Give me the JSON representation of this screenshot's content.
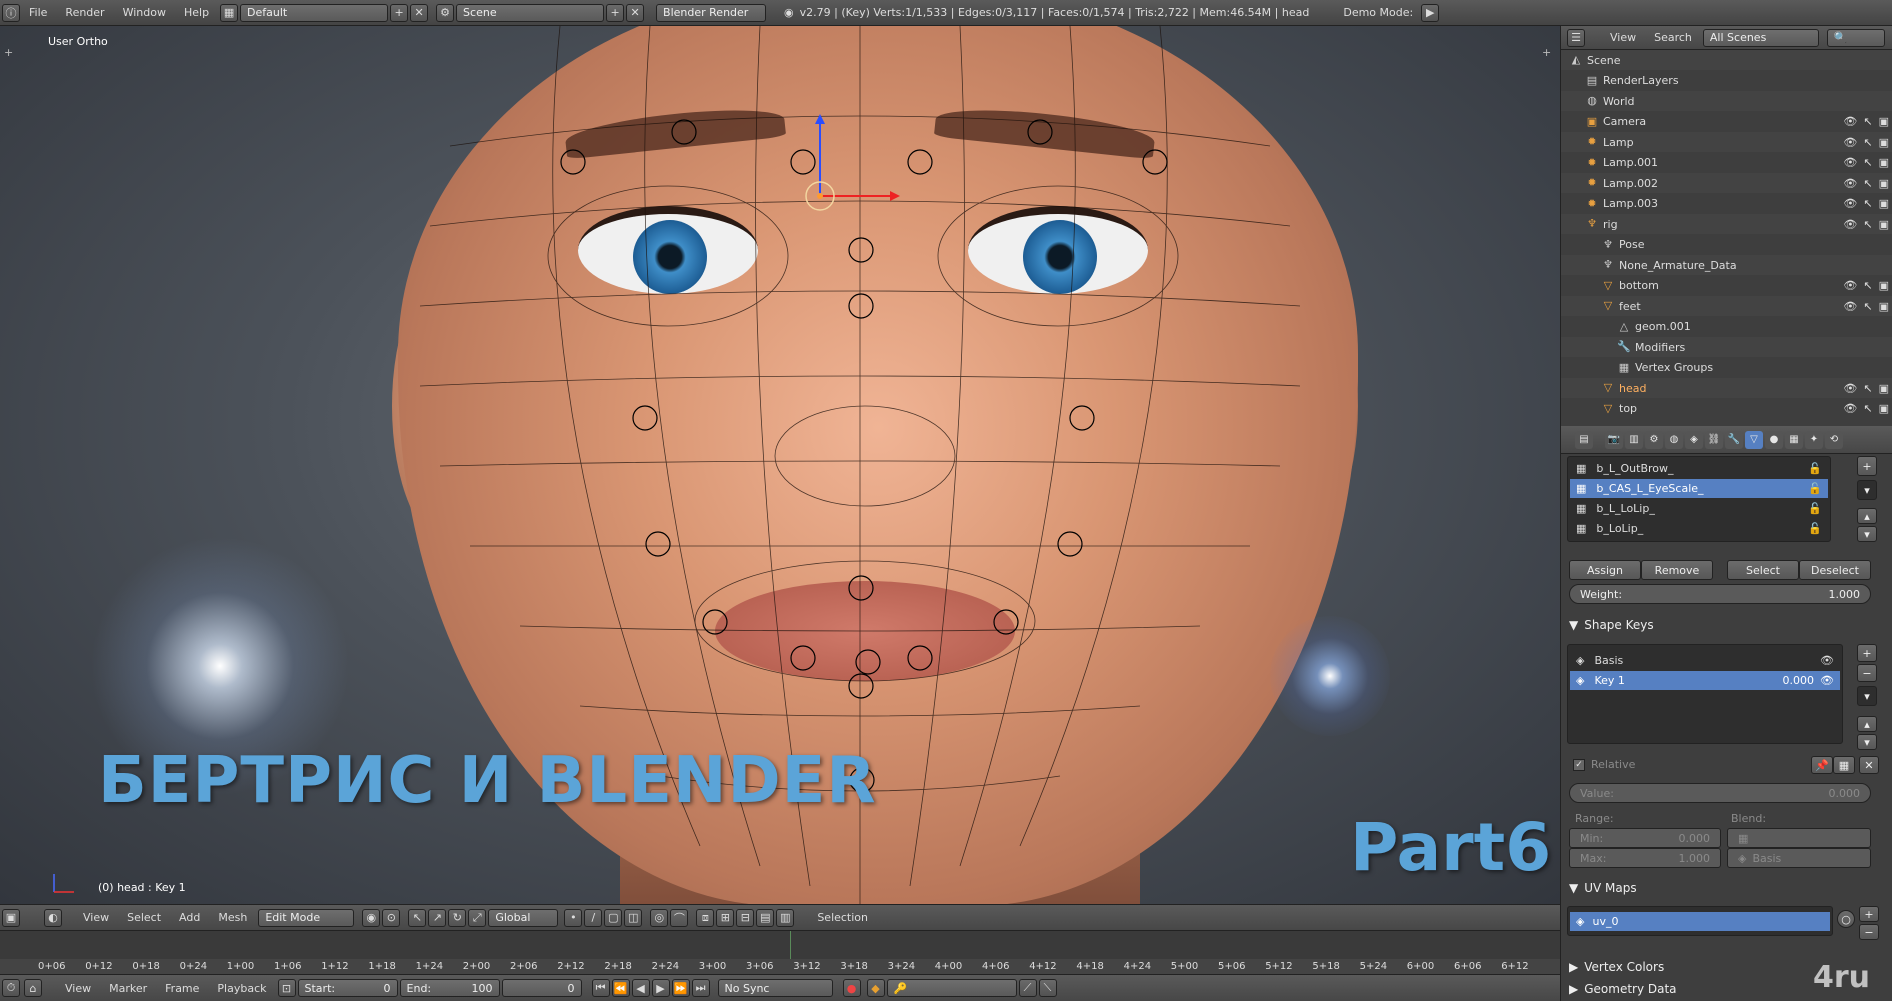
{
  "topbar": {
    "menus": [
      "File",
      "Render",
      "Window",
      "Help"
    ],
    "layout": "Default",
    "scene": "Scene",
    "engine": "Blender Render",
    "stats": "v2.79 | (Key) Verts:1/1,533 | Edges:0/3,117 | Faces:0/1,574 | Tris:2,722 | Mem:46.54M | head",
    "demo_mode": "Demo Mode:"
  },
  "viewport": {
    "view_label": "User Ortho",
    "object_label": "(0) head : Key 1",
    "overlay_title": "БЕРТРИС И BLENDER",
    "overlay_part": "Part6"
  },
  "viewport_header": {
    "menus": [
      "View",
      "Select",
      "Add",
      "Mesh"
    ],
    "mode": "Edit Mode",
    "orientation": "Global",
    "selection_label": "Selection"
  },
  "timeline": {
    "ticks": [
      "0+06",
      "0+12",
      "0+18",
      "0+24",
      "1+00",
      "1+06",
      "1+12",
      "1+18",
      "1+24",
      "2+00",
      "2+06",
      "2+12",
      "2+18",
      "2+24",
      "3+00",
      "3+06",
      "3+12",
      "3+18",
      "3+24",
      "4+00",
      "4+06",
      "4+12",
      "4+18",
      "4+24",
      "5+00",
      "5+06",
      "5+12",
      "5+18",
      "5+24",
      "6+00",
      "6+06",
      "6+12"
    ],
    "menus": [
      "View",
      "Marker",
      "Frame",
      "Playback"
    ],
    "start_label": "Start:",
    "start_value": "0",
    "end_label": "End:",
    "end_value": "100",
    "current_frame": "0",
    "sync": "No Sync"
  },
  "outliner": {
    "menus": [
      "View",
      "Search"
    ],
    "filter": "All Scenes",
    "rows": [
      {
        "label": "Scene",
        "icon": "scene-icon"
      },
      {
        "label": "RenderLayers",
        "icon": "render-layers-icon"
      },
      {
        "label": "World",
        "icon": "world-icon"
      },
      {
        "label": "Camera",
        "icon": "camera-icon"
      },
      {
        "label": "Lamp",
        "icon": "lamp-icon"
      },
      {
        "label": "Lamp.001",
        "icon": "lamp-icon"
      },
      {
        "label": "Lamp.002",
        "icon": "lamp-icon"
      },
      {
        "label": "Lamp.003",
        "icon": "lamp-icon"
      },
      {
        "label": "rig",
        "icon": "armature-icon"
      },
      {
        "label": "Pose",
        "icon": "pose-icon"
      },
      {
        "label": "None_Armature_Data",
        "icon": "armature-data-icon"
      },
      {
        "label": "bottom",
        "icon": "mesh-icon"
      },
      {
        "label": "feet",
        "icon": "mesh-icon"
      },
      {
        "label": "geom.001",
        "icon": "mesh-data-icon"
      },
      {
        "label": "Modifiers",
        "icon": "wrench-icon"
      },
      {
        "label": "Vertex Groups",
        "icon": "vertex-group-icon"
      },
      {
        "label": "head",
        "icon": "mesh-icon"
      },
      {
        "label": "top",
        "icon": "mesh-icon"
      }
    ]
  },
  "properties": {
    "vertex_groups": [
      "b_L_OutBrow_",
      "b_CAS_L_EyeScale_",
      "b_L_LoLip_",
      "b_LoLip_"
    ],
    "vg_buttons": {
      "assign": "Assign",
      "remove": "Remove",
      "select": "Select",
      "deselect": "Deselect"
    },
    "weight_label": "Weight:",
    "weight_value": "1.000",
    "shape_keys_title": "Shape Keys",
    "shape_keys": [
      {
        "name": "Basis",
        "value": ""
      },
      {
        "name": "Key 1",
        "value": "0.000"
      }
    ],
    "relative_label": "Relative",
    "value_label": "Value:",
    "value_value": "0.000",
    "range_label": "Range:",
    "blend_label": "Blend:",
    "min_label": "Min:",
    "min_value": "0.000",
    "max_label": "Max:",
    "max_value": "1.000",
    "blend_value": "Basis",
    "uv_maps_title": "UV Maps",
    "uv_map": "uv_0",
    "vertex_colors_title": "Vertex Colors",
    "geometry_data_title": "Geometry Data"
  },
  "watermark": "4ru",
  "colors": {
    "selection": "#5680c2",
    "overlay_text": "#5ba4d8",
    "panel_bg": "#3e3e3e"
  }
}
